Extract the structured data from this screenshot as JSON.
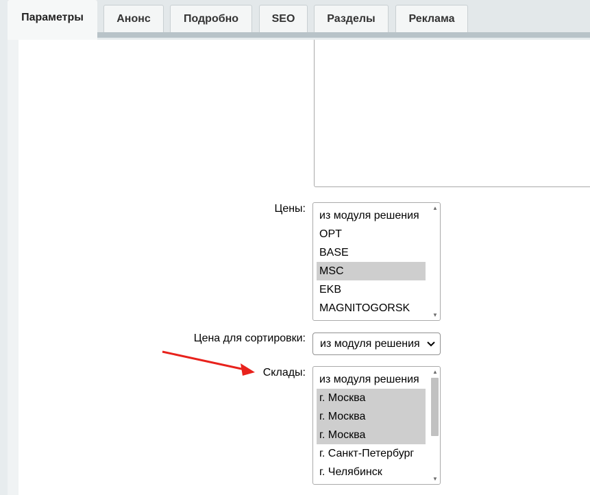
{
  "tabs": [
    {
      "label": "Параметры",
      "active": true
    },
    {
      "label": "Анонс"
    },
    {
      "label": "Подробно"
    },
    {
      "label": "SEO"
    },
    {
      "label": "Разделы"
    },
    {
      "label": "Реклама"
    }
  ],
  "form": {
    "prices": {
      "label": "Цены:",
      "options": [
        "из модуля решения",
        "OPT",
        "BASE",
        "MSC",
        "EKB",
        "MAGNITOGORSK"
      ],
      "selected": [
        "MSC"
      ]
    },
    "sort_price": {
      "label": "Цена для сортировки:",
      "value": "из модуля решения"
    },
    "warehouses": {
      "label": "Склады:",
      "options": [
        "из модуля решения",
        "г. Москва",
        "г. Москва",
        "г. Москва",
        "г. Санкт-Петербург",
        "г. Челябинск"
      ],
      "selected": [
        "г. Москва",
        "г. Москва",
        "г. Москва"
      ]
    }
  },
  "annotation": {
    "arrow_color": "#e8221c"
  },
  "icons": {
    "select_chevron": "chevron-down-icon"
  }
}
